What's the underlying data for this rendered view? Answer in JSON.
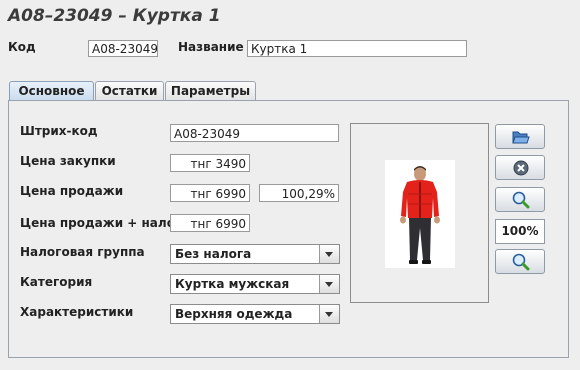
{
  "window": {
    "title": "A08–23049 – Куртка 1"
  },
  "header": {
    "code_label": "Код",
    "code_value": "A08-23049",
    "name_label": "Название",
    "name_value": "Куртка 1"
  },
  "tabs": [
    {
      "label": "Основное",
      "active": true
    },
    {
      "label": "Остатки",
      "active": false
    },
    {
      "label": "Параметры",
      "active": false
    }
  ],
  "form": {
    "barcode_label": "Штрих-код",
    "barcode_value": "A08-23049",
    "purchase_price_label": "Цена закупки",
    "purchase_price_value": "тнг 3490",
    "sale_price_label": "Цена продажи",
    "sale_price_value": "тнг 6990",
    "markup_value": "100,29%",
    "sale_price_tax_label": "Цена продажи + налог",
    "sale_price_tax_value": "тнг 6990",
    "tax_group_label": "Налоговая группа",
    "tax_group_value": "Без налога",
    "category_label": "Категория",
    "category_value": "Куртка мужская",
    "attributes_label": "Характеристики",
    "attributes_value": "Верхняя одежда"
  },
  "image_panel": {
    "zoom": "100%",
    "buttons": [
      "open-folder-icon",
      "delete-icon",
      "zoom-in-icon",
      "zoom-out-icon"
    ]
  },
  "colors": {
    "jacket": "#e3231b",
    "tab_active": "#c9dbee",
    "background": "#eeeeee"
  }
}
